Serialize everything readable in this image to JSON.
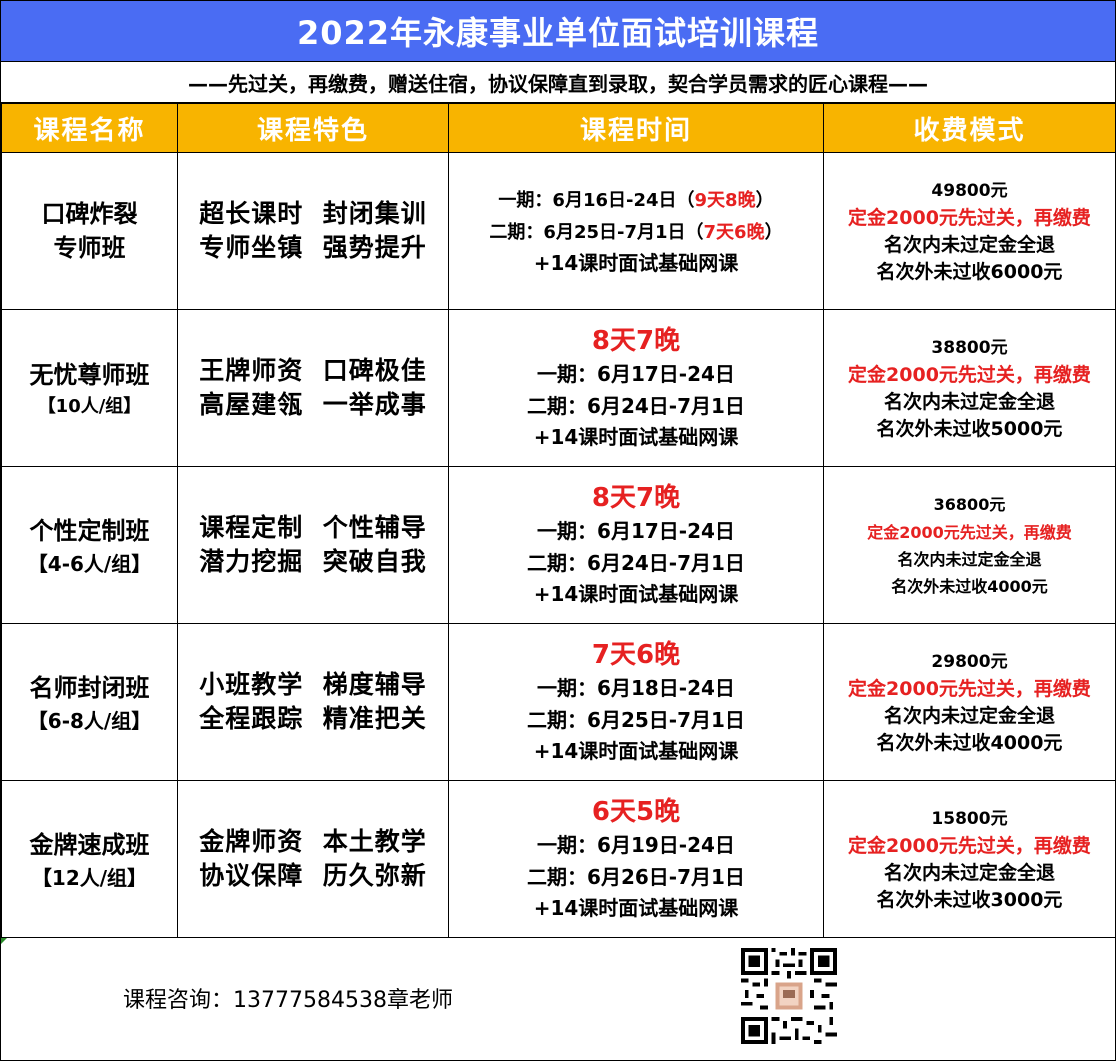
{
  "title": "2022年永康事业单位面试培训课程",
  "subtitle": "——先过关，再缴费，赠送住宿，协议保障直到录取，契合学员需求的匠心课程——",
  "headers": [
    "课程名称",
    "课程特色",
    "课程时间",
    "收费模式"
  ],
  "rows": [
    {
      "name": "口碑炸裂",
      "name2": "专师班",
      "sub": "",
      "features": [
        "超长课时  封闭集训",
        "专师坐镇  强势提升"
      ],
      "period1_prefix": "一期：6月16日-24日（",
      "period1_red": "9天8晚",
      "period1_suffix": "）",
      "period2_prefix": "二期：6月25日-7月1日（",
      "period2_red": "7天6晚",
      "period2_suffix": "）",
      "net": "+14课时面试基础网课",
      "price": "49800元",
      "deposit": "定金2000元先过关，再缴费",
      "refund_in": "名次内未过定金全退",
      "refund_out": "名次外未过收6000元"
    },
    {
      "name": "无忧尊师班",
      "sub": "【10人/组】",
      "features": [
        "王牌师资  口碑极佳",
        "高屋建瓴  一举成事"
      ],
      "duration": "8天7晚",
      "period1": "一期：6月17日-24日",
      "period2": "二期：6月24日-7月1日",
      "net": "+14课时面试基础网课",
      "price": "38800元",
      "deposit": "定金2000元先过关，再缴费",
      "refund_in": "名次内未过定金全退",
      "refund_out": "名次外未过收5000元"
    },
    {
      "name": "个性定制班",
      "sub": "【4-6人/组】",
      "features": [
        "课程定制  个性辅导",
        "潜力挖掘  突破自我"
      ],
      "duration": "8天7晚",
      "period1": "一期：6月17日-24日",
      "period2": "二期：6月24日-7月1日",
      "net": "+14课时面试基础网课",
      "price": "36800元",
      "deposit": "定金2000元先过关，再缴费",
      "refund_in": "名次内未过定金全退",
      "refund_out": "名次外未过收4000元"
    },
    {
      "name": "名师封闭班",
      "sub": "【6-8人/组】",
      "features": [
        "小班教学  梯度辅导",
        "全程跟踪  精准把关"
      ],
      "duration": "7天6晚",
      "period1": "一期：6月18日-24日",
      "period2": "二期：6月25日-7月1日",
      "net": "+14课时面试基础网课",
      "price": "29800元",
      "deposit": "定金2000元先过关，再缴费",
      "refund_in": "名次内未过定金全退",
      "refund_out": "名次外未过收4000元"
    },
    {
      "name": "金牌速成班",
      "sub": "【12人/组】",
      "features": [
        "金牌师资  本土教学",
        "协议保障  历久弥新"
      ],
      "duration": "6天5晚",
      "period1": "一期：6月19日-24日",
      "period2": "二期：6月26日-7月1日",
      "net": "+14课时面试基础网课",
      "price": "15800元",
      "deposit": "定金2000元先过关，再缴费",
      "refund_in": "名次内未过定金全退",
      "refund_out": "名次外未过收3000元"
    }
  ],
  "consult": "课程咨询：13777584538章老师",
  "colors": {
    "title_bg": "#4a6cf3",
    "header_bg": "#f8b400",
    "accent_red": "#e62121"
  },
  "icons": {
    "qr": "qr-code-icon"
  }
}
